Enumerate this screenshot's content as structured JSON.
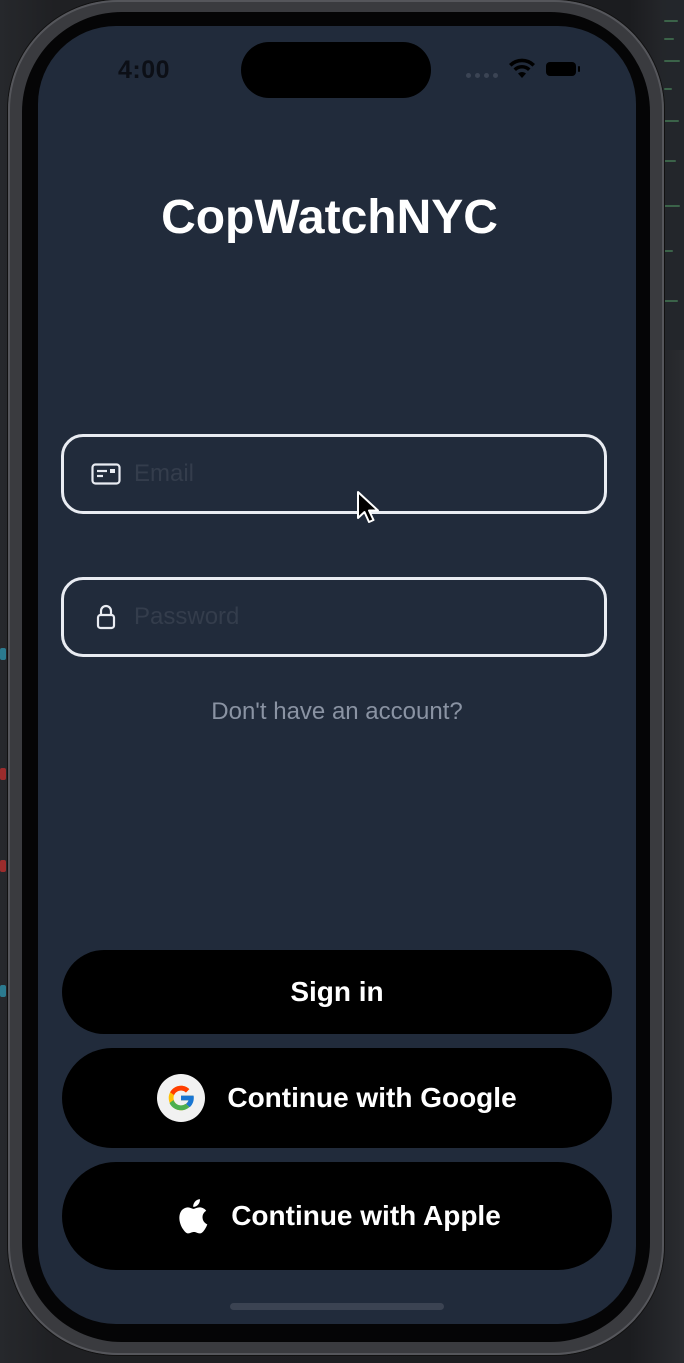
{
  "status_bar": {
    "time": "4:00"
  },
  "app": {
    "title": "CopWatchNYC"
  },
  "form": {
    "email": {
      "value": "",
      "placeholder": "Email",
      "icon": "id-card-icon"
    },
    "password": {
      "value": "",
      "placeholder": "Password",
      "icon": "lock-icon"
    },
    "signup_link": "Don't have an account?"
  },
  "actions": {
    "sign_in_label": "Sign in",
    "google_label": "Continue with Google",
    "apple_label": "Continue with Apple"
  },
  "colors": {
    "screen_background": "#212b3b",
    "button_background": "#000000",
    "field_border": "#e9ecf2",
    "text_primary": "#ffffff",
    "text_muted": "#8a93a3"
  }
}
